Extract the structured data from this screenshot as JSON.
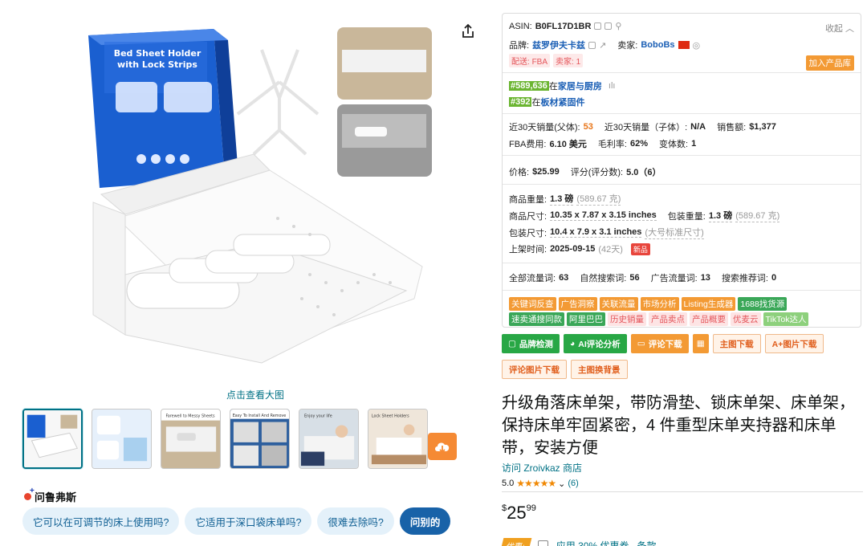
{
  "gallery": {
    "view_large": "点击查看大图",
    "box_title_line1": "Bed Sheet Holder",
    "box_title_line2": "with Lock Strips",
    "thumbnails": [
      {
        "caption": ""
      },
      {
        "caption": ""
      },
      {
        "caption": "Farewell to Messy Sheets"
      },
      {
        "caption": "Easy To Install And Remove"
      },
      {
        "caption": "Enjoy your life"
      },
      {
        "caption": "Lock Sheet Holders"
      }
    ]
  },
  "rufus": {
    "title": "问鲁弗斯",
    "questions": [
      "它可以在可调节的床上使用吗?",
      "它适用于深口袋床单吗?",
      "很难去除吗?"
    ],
    "ask_other": "问别的"
  },
  "panel": {
    "asin_label": "ASIN:",
    "asin": "B0FL17D1BR",
    "collapse": "收起",
    "brand_label": "品牌:",
    "brand": "兹罗伊夫卡兹",
    "seller_label": "卖家:",
    "seller": "BoboBs",
    "ship_label": "配送:",
    "ship": "FBA",
    "sellers_count": "卖家: 1",
    "add_to_lib": "加入产品库",
    "rank1": "#589,636",
    "rank1_in": "在",
    "rank1_cat": "家居与厨房",
    "rank2": "#392",
    "rank2_in": "在",
    "rank2_cat": "板材紧固件",
    "sales_parent_label": "近30天销量(父体):",
    "sales_parent": "53",
    "sales_child_label": "近30天销量（子体）:",
    "sales_child": "N/A",
    "revenue_label": "销售额:",
    "revenue": "$1,377",
    "fba_label": "FBA费用:",
    "fba": "6.10 美元",
    "margin_label": "毛利率:",
    "margin": "62%",
    "variants_label": "变体数:",
    "variants": "1",
    "price_label": "价格:",
    "price": "$25.99",
    "rating_label": "评分(评分数):",
    "rating": "5.0（6）",
    "weight_label": "商品重量:",
    "weight": "1.3 磅",
    "weight_g": "(589.67 克)",
    "dims_label": "商品尺寸:",
    "dims": "10.35 x 7.87 x 3.15 inches",
    "pkg_weight_label": "包装重量:",
    "pkg_weight": "1.3 磅",
    "pkg_weight_g": "(589.67 克)",
    "pkg_dims_label": "包装尺寸:",
    "pkg_dims": "10.4 x 7.9 x 3.1 inches",
    "pkg_size_class": "(大号标准尺寸)",
    "launch_label": "上架时间:",
    "launch": "2025-09-15",
    "launch_days": "(42天)",
    "new_tag": "新品",
    "kw_total_label": "全部流量词:",
    "kw_total": "63",
    "kw_organic_label": "自然搜索词:",
    "kw_organic": "56",
    "kw_ad_label": "广告流量词:",
    "kw_ad": "13",
    "kw_rec_label": "搜索推荐词:",
    "kw_rec": "0",
    "tags_row1": [
      "关键词反查",
      "广告洞察",
      "关联流量",
      "市场分析",
      "Listing生成器",
      "1688找货源"
    ],
    "tags_row2": [
      "速卖通搜同款",
      "阿里巴巴",
      "历史销量",
      "产品卖点",
      "产品概要",
      "优麦云",
      "TikTok达人"
    ]
  },
  "actions": {
    "brand_check": "品牌检测",
    "ai_review": "AI评论分析",
    "review_download": "评论下载",
    "main_img_download": "主图下载",
    "aplus_download": "A+图片下载",
    "review_img_download": "评论图片下载",
    "main_bg_change": "主图换背景"
  },
  "product": {
    "title": "升级角落床单架，带防滑垫、锁床单架、床单架，保持床单牢固紧密，4 件重型床单夹持器和床单带，安装方便",
    "store": "访问 Zroivkaz 商店",
    "rating": "5.0",
    "stars": "★★★★★",
    "rating_count": "(6)",
    "price_symbol": "$",
    "price_whole": "25",
    "price_cents": "99",
    "coupon_badge": "优惠:",
    "coupon_text": "应用 30% 优惠券",
    "coupon_terms": "条款"
  },
  "colors": {
    "accent_orange": "#f39a34",
    "link_blue": "#007185",
    "rank_green": "#6bb531",
    "box_blue": "#1a5fd0"
  }
}
